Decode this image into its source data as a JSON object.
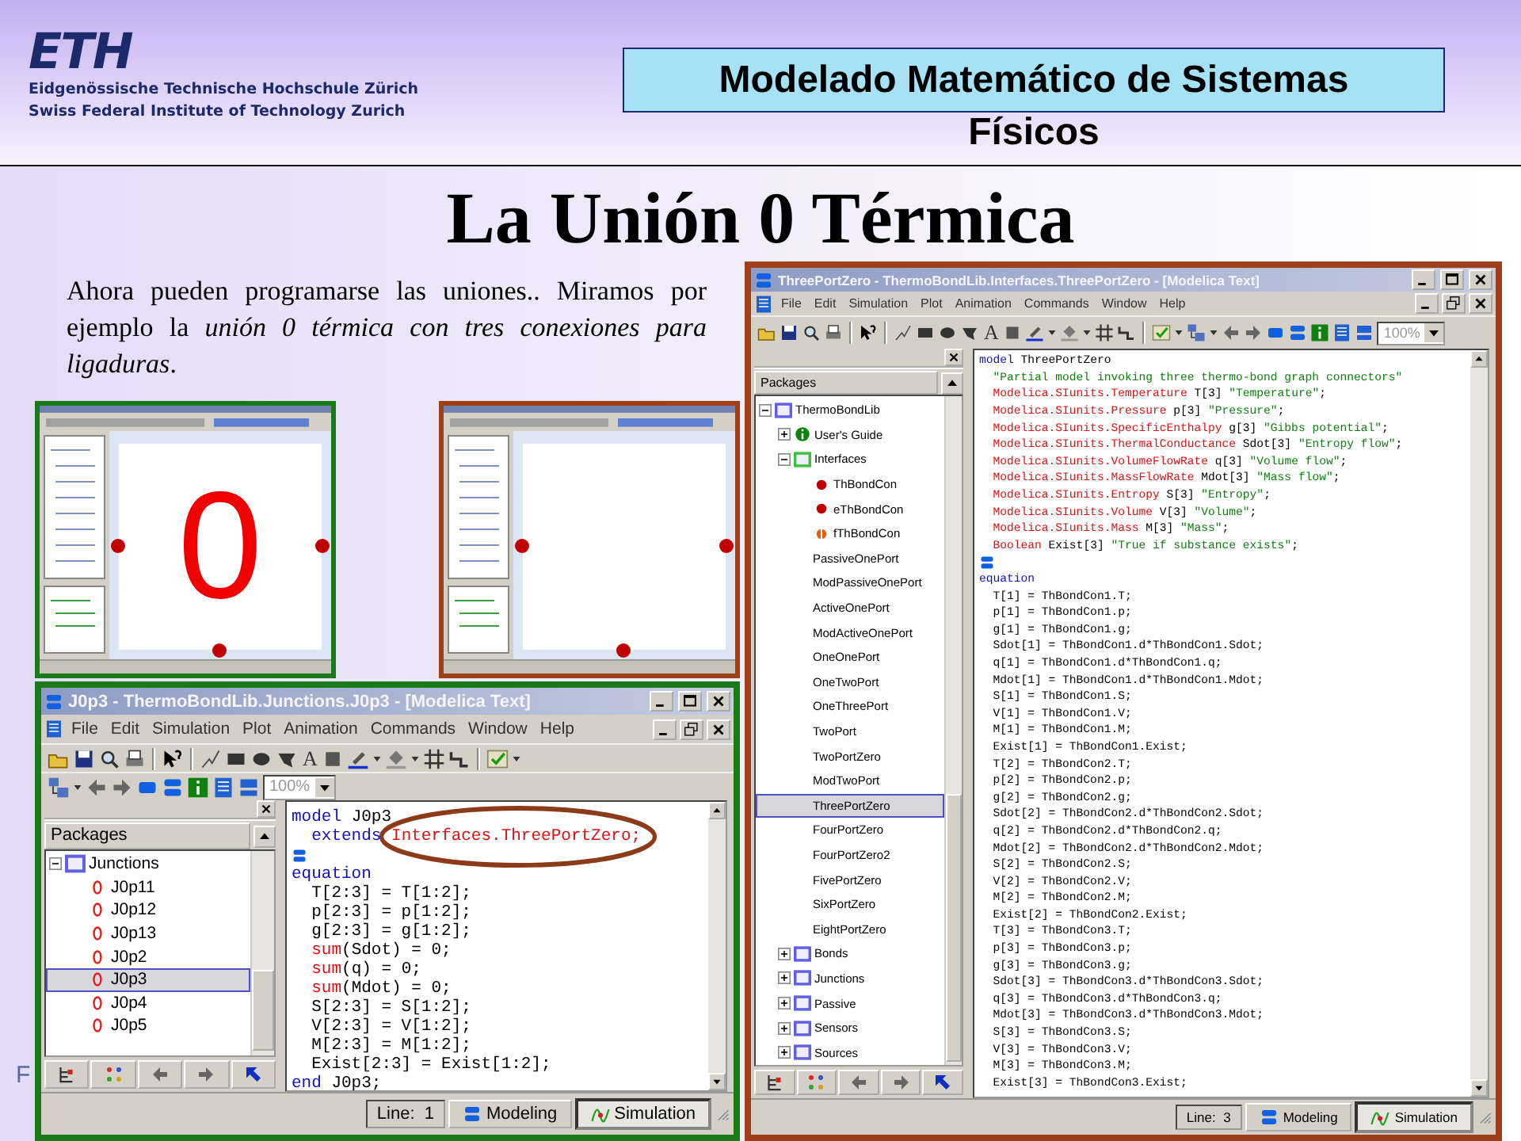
{
  "logo": {
    "mark": "ETH",
    "lines": [
      "Eidgenössische Technische Hochschule Zürich",
      "Swiss Federal Institute of Technology Zurich"
    ]
  },
  "header_title": [
    "Modelado Matemático de Sistemas",
    "Físicos"
  ],
  "title": "La Unión 0 Térmica",
  "paragraph": "Ahora pueden programarse las uniones.. Miramos por ejemplo la *unión 0 térmica con tres conexiones para ligaduras*.",
  "thumbnails": [
    {
      "color": "#1a7a1a",
      "symbol": "0"
    },
    {
      "color": "#a0401a"
    }
  ],
  "footer": "F",
  "windows": [
    {
      "title": "J0p3 - ThermoBondLib.Junctions.J0p3 - [Modelica Text]",
      "color": "#1a7a1a",
      "menu": [
        "File",
        "Edit",
        "Simulation",
        "Plot",
        "Animation",
        "Commands",
        "Window",
        "Help"
      ],
      "text_tool": "A",
      "zoom": "100%",
      "panel_title": "Packages",
      "tree": [
        {
          "label": "Junctions",
          "kind": "package",
          "color": "#6060e0",
          "expanded": true,
          "selected": false,
          "children": [
            {
              "label": "J0p11",
              "kind": "junction",
              "selected": false
            },
            {
              "label": "J0p12",
              "kind": "junction",
              "selected": false
            },
            {
              "label": "J0p13",
              "kind": "junction",
              "selected": false
            },
            {
              "label": "J0p2",
              "kind": "junction",
              "selected": false
            },
            {
              "label": "J0p3",
              "kind": "junction",
              "selected": true
            },
            {
              "label": "J0p4",
              "kind": "junction",
              "selected": false
            },
            {
              "label": "J0p5",
              "kind": "junction",
              "selected": false
            }
          ]
        }
      ],
      "code": [
        {
          "kind": "code",
          "segments": [
            {
              "kind": "keyword",
              "text": "model"
            },
            {
              "kind": "plain",
              "text": " J0p3"
            }
          ]
        },
        {
          "kind": "code",
          "circled": true,
          "segments": [
            {
              "kind": "keyword",
              "text": "  extends"
            },
            {
              "kind": "type",
              "text": " Interfaces.ThreePortZero;"
            }
          ]
        },
        {
          "kind": "annotation"
        },
        {
          "kind": "code",
          "segments": [
            {
              "kind": "keyword",
              "text": "equation"
            }
          ]
        },
        {
          "kind": "code",
          "segments": [
            {
              "kind": "plain",
              "text": "  T[2:3] = T[1:2];"
            }
          ]
        },
        {
          "kind": "code",
          "segments": [
            {
              "kind": "plain",
              "text": "  p[2:3] = p[1:2];"
            }
          ]
        },
        {
          "kind": "code",
          "segments": [
            {
              "kind": "plain",
              "text": "  g[2:3] = g[1:2];"
            }
          ]
        },
        {
          "kind": "code",
          "segments": [
            {
              "kind": "type",
              "text": "  sum"
            },
            {
              "kind": "plain",
              "text": "(Sdot) = 0;"
            }
          ]
        },
        {
          "kind": "code",
          "segments": [
            {
              "kind": "type",
              "text": "  sum"
            },
            {
              "kind": "plain",
              "text": "(q) = 0;"
            }
          ]
        },
        {
          "kind": "code",
          "segments": [
            {
              "kind": "type",
              "text": "  sum"
            },
            {
              "kind": "plain",
              "text": "(Mdot) = 0;"
            }
          ]
        },
        {
          "kind": "code",
          "segments": [
            {
              "kind": "plain",
              "text": "  S[2:3] = S[1:2];"
            }
          ]
        },
        {
          "kind": "code",
          "segments": [
            {
              "kind": "plain",
              "text": "  V[2:3] = V[1:2];"
            }
          ]
        },
        {
          "kind": "code",
          "segments": [
            {
              "kind": "plain",
              "text": "  M[2:3] = M[1:2];"
            }
          ]
        },
        {
          "kind": "code",
          "segments": [
            {
              "kind": "plain",
              "text": "  Exist[2:3] = Exist[1:2];"
            }
          ]
        },
        {
          "kind": "code",
          "segments": [
            {
              "kind": "keyword",
              "text": "end"
            },
            {
              "kind": "plain",
              "text": " J0p3;"
            }
          ]
        }
      ],
      "status": {
        "line_label": "Line:",
        "line": "1",
        "buttons": [
          {
            "label": "Modeling",
            "kind": "modeling",
            "selected": false
          },
          {
            "label": "Simulation",
            "kind": "simulation",
            "selected": true
          }
        ]
      }
    },
    {
      "title": "ThreePortZero - ThermoBondLib.Interfaces.ThreePortZero - [Modelica Text]",
      "color": "#a0401a",
      "menu": [
        "File",
        "Edit",
        "Simulation",
        "Plot",
        "Animation",
        "Commands",
        "Window",
        "Help"
      ],
      "text_tool": "A",
      "zoom": "100%",
      "panel_title": "Packages",
      "tree": [
        {
          "label": "ThermoBondLib",
          "kind": "package",
          "color": "#6060e0",
          "expanded": true,
          "selected": false,
          "children": [
            {
              "label": "User's Guide",
              "kind": "info",
              "expanded": false,
              "selected": false
            },
            {
              "label": "Interfaces",
              "kind": "package",
              "color": "#40c040",
              "expanded": true,
              "selected": false,
              "children": [
                {
                  "label": "ThBondCon",
                  "kind": "connector",
                  "selected": false
                },
                {
                  "label": "eThBondCon",
                  "kind": "connector",
                  "selected": false
                },
                {
                  "label": "fThBondCon",
                  "kind": "connector-half",
                  "selected": false
                },
                {
                  "label": "PassiveOnePort",
                  "kind": "model",
                  "selected": false
                },
                {
                  "label": "ModPassiveOnePort",
                  "kind": "model",
                  "selected": false
                },
                {
                  "label": "ActiveOnePort",
                  "kind": "model",
                  "selected": false
                },
                {
                  "label": "ModActiveOnePort",
                  "kind": "model",
                  "selected": false
                },
                {
                  "label": "OneOnePort",
                  "kind": "model",
                  "selected": false
                },
                {
                  "label": "OneTwoPort",
                  "kind": "model",
                  "selected": false
                },
                {
                  "label": "OneThreePort",
                  "kind": "model",
                  "selected": false
                },
                {
                  "label": "TwoPort",
                  "kind": "model",
                  "selected": false
                },
                {
                  "label": "TwoPortZero",
                  "kind": "model",
                  "selected": false
                },
                {
                  "label": "ModTwoPort",
                  "kind": "model",
                  "selected": false
                },
                {
                  "label": "ThreePortZero",
                  "kind": "model",
                  "selected": true
                },
                {
                  "label": "FourPortZero",
                  "kind": "model",
                  "selected": false
                },
                {
                  "label": "FourPortZero2",
                  "kind": "model",
                  "selected": false
                },
                {
                  "label": "FivePortZero",
                  "kind": "model",
                  "selected": false
                },
                {
                  "label": "SixPortZero",
                  "kind": "model",
                  "selected": false
                },
                {
                  "label": "EightPortZero",
                  "kind": "model",
                  "selected": false
                }
              ]
            },
            {
              "label": "Bonds",
              "kind": "package",
              "color": "#6060e0",
              "expanded": false,
              "selected": false
            },
            {
              "label": "Junctions",
              "kind": "package",
              "color": "#6060e0",
              "expanded": false,
              "selected": false
            },
            {
              "label": "Passive",
              "kind": "package",
              "color": "#6060e0",
              "expanded": false,
              "selected": false
            },
            {
              "label": "Sensors",
              "kind": "package",
              "color": "#6060e0",
              "expanded": false,
              "selected": false
            },
            {
              "label": "Sources",
              "kind": "package",
              "color": "#6060e0",
              "expanded": false,
              "selected": false
            }
          ]
        }
      ],
      "code": [
        {
          "kind": "code",
          "segments": [
            {
              "kind": "keyword",
              "text": "model"
            },
            {
              "kind": "plain",
              "text": " ThreePortZero"
            }
          ]
        },
        {
          "kind": "code",
          "segments": [
            {
              "kind": "string",
              "text": "  \"Partial model invoking three thermo-bond graph connectors\""
            }
          ]
        },
        {
          "kind": "code",
          "segments": [
            {
              "kind": "type",
              "text": "  Modelica.SIunits.Temperature"
            },
            {
              "kind": "plain",
              "text": " T[3] "
            },
            {
              "kind": "string",
              "text": "\"Temperature\""
            },
            {
              "kind": "plain",
              "text": ";"
            }
          ]
        },
        {
          "kind": "code",
          "segments": [
            {
              "kind": "type",
              "text": "  Modelica.SIunits.Pressure"
            },
            {
              "kind": "plain",
              "text": " p[3] "
            },
            {
              "kind": "string",
              "text": "\"Pressure\""
            },
            {
              "kind": "plain",
              "text": ";"
            }
          ]
        },
        {
          "kind": "code",
          "segments": [
            {
              "kind": "type",
              "text": "  Modelica.SIunits.SpecificEnthalpy"
            },
            {
              "kind": "plain",
              "text": " g[3] "
            },
            {
              "kind": "string",
              "text": "\"Gibbs potential\""
            },
            {
              "kind": "plain",
              "text": ";"
            }
          ]
        },
        {
          "kind": "code",
          "segments": [
            {
              "kind": "type",
              "text": "  Modelica.SIunits.ThermalConductance"
            },
            {
              "kind": "plain",
              "text": " Sdot[3] "
            },
            {
              "kind": "string",
              "text": "\"Entropy flow\""
            },
            {
              "kind": "plain",
              "text": ";"
            }
          ]
        },
        {
          "kind": "code",
          "segments": [
            {
              "kind": "type",
              "text": "  Modelica.SIunits.VolumeFlowRate"
            },
            {
              "kind": "plain",
              "text": " q[3] "
            },
            {
              "kind": "string",
              "text": "\"Volume flow\""
            },
            {
              "kind": "plain",
              "text": ";"
            }
          ]
        },
        {
          "kind": "code",
          "segments": [
            {
              "kind": "type",
              "text": "  Modelica.SIunits.MassFlowRate"
            },
            {
              "kind": "plain",
              "text": " Mdot[3] "
            },
            {
              "kind": "string",
              "text": "\"Mass flow\""
            },
            {
              "kind": "plain",
              "text": ";"
            }
          ]
        },
        {
          "kind": "code",
          "segments": [
            {
              "kind": "type",
              "text": "  Modelica.SIunits.Entropy"
            },
            {
              "kind": "plain",
              "text": " S[3] "
            },
            {
              "kind": "string",
              "text": "\"Entropy\""
            },
            {
              "kind": "plain",
              "text": ";"
            }
          ]
        },
        {
          "kind": "code",
          "segments": [
            {
              "kind": "type",
              "text": "  Modelica.SIunits.Volume"
            },
            {
              "kind": "plain",
              "text": " V[3] "
            },
            {
              "kind": "string",
              "text": "\"Volume\""
            },
            {
              "kind": "plain",
              "text": ";"
            }
          ]
        },
        {
          "kind": "code",
          "segments": [
            {
              "kind": "type",
              "text": "  Modelica.SIunits.Mass"
            },
            {
              "kind": "plain",
              "text": " M[3] "
            },
            {
              "kind": "string",
              "text": "\"Mass\""
            },
            {
              "kind": "plain",
              "text": ";"
            }
          ]
        },
        {
          "kind": "code",
          "segments": [
            {
              "kind": "type",
              "text": "  Boolean"
            },
            {
              "kind": "plain",
              "text": " Exist[3] "
            },
            {
              "kind": "string",
              "text": "\"True if substance exists\""
            },
            {
              "kind": "plain",
              "text": ";"
            }
          ]
        },
        {
          "kind": "annotation"
        },
        {
          "kind": "code",
          "segments": [
            {
              "kind": "keyword",
              "text": "equation"
            }
          ]
        },
        {
          "kind": "code",
          "segments": [
            {
              "kind": "plain",
              "text": "  T[1] = ThBondCon1.T;"
            }
          ]
        },
        {
          "kind": "code",
          "segments": [
            {
              "kind": "plain",
              "text": "  p[1] = ThBondCon1.p;"
            }
          ]
        },
        {
          "kind": "code",
          "segments": [
            {
              "kind": "plain",
              "text": "  g[1] = ThBondCon1.g;"
            }
          ]
        },
        {
          "kind": "code",
          "segments": [
            {
              "kind": "plain",
              "text": "  Sdot[1] = ThBondCon1.d*ThBondCon1.Sdot;"
            }
          ]
        },
        {
          "kind": "code",
          "segments": [
            {
              "kind": "plain",
              "text": "  q[1] = ThBondCon1.d*ThBondCon1.q;"
            }
          ]
        },
        {
          "kind": "code",
          "segments": [
            {
              "kind": "plain",
              "text": "  Mdot[1] = ThBondCon1.d*ThBondCon1.Mdot;"
            }
          ]
        },
        {
          "kind": "code",
          "segments": [
            {
              "kind": "plain",
              "text": "  S[1] = ThBondCon1.S;"
            }
          ]
        },
        {
          "kind": "code",
          "segments": [
            {
              "kind": "plain",
              "text": "  V[1] = ThBondCon1.V;"
            }
          ]
        },
        {
          "kind": "code",
          "segments": [
            {
              "kind": "plain",
              "text": "  M[1] = ThBondCon1.M;"
            }
          ]
        },
        {
          "kind": "code",
          "segments": [
            {
              "kind": "plain",
              "text": "  Exist[1] = ThBondCon1.Exist;"
            }
          ]
        },
        {
          "kind": "code",
          "segments": [
            {
              "kind": "plain",
              "text": "  T[2] = ThBondCon2.T;"
            }
          ]
        },
        {
          "kind": "code",
          "segments": [
            {
              "kind": "plain",
              "text": "  p[2] = ThBondCon2.p;"
            }
          ]
        },
        {
          "kind": "code",
          "segments": [
            {
              "kind": "plain",
              "text": "  g[2] = ThBondCon2.g;"
            }
          ]
        },
        {
          "kind": "code",
          "segments": [
            {
              "kind": "plain",
              "text": "  Sdot[2] = ThBondCon2.d*ThBondCon2.Sdot;"
            }
          ]
        },
        {
          "kind": "code",
          "segments": [
            {
              "kind": "plain",
              "text": "  q[2] = ThBondCon2.d*ThBondCon2.q;"
            }
          ]
        },
        {
          "kind": "code",
          "segments": [
            {
              "kind": "plain",
              "text": "  Mdot[2] = ThBondCon2.d*ThBondCon2.Mdot;"
            }
          ]
        },
        {
          "kind": "code",
          "segments": [
            {
              "kind": "plain",
              "text": "  S[2] = ThBondCon2.S;"
            }
          ]
        },
        {
          "kind": "code",
          "segments": [
            {
              "kind": "plain",
              "text": "  V[2] = ThBondCon2.V;"
            }
          ]
        },
        {
          "kind": "code",
          "segments": [
            {
              "kind": "plain",
              "text": "  M[2] = ThBondCon2.M;"
            }
          ]
        },
        {
          "kind": "code",
          "segments": [
            {
              "kind": "plain",
              "text": "  Exist[2] = ThBondCon2.Exist;"
            }
          ]
        },
        {
          "kind": "code",
          "segments": [
            {
              "kind": "plain",
              "text": "  T[3] = ThBondCon3.T;"
            }
          ]
        },
        {
          "kind": "code",
          "segments": [
            {
              "kind": "plain",
              "text": "  p[3] = ThBondCon3.p;"
            }
          ]
        },
        {
          "kind": "code",
          "segments": [
            {
              "kind": "plain",
              "text": "  g[3] = ThBondCon3.g;"
            }
          ]
        },
        {
          "kind": "code",
          "segments": [
            {
              "kind": "plain",
              "text": "  Sdot[3] = ThBondCon3.d*ThBondCon3.Sdot;"
            }
          ]
        },
        {
          "kind": "code",
          "segments": [
            {
              "kind": "plain",
              "text": "  q[3] = ThBondCon3.d*ThBondCon3.q;"
            }
          ]
        },
        {
          "kind": "code",
          "segments": [
            {
              "kind": "plain",
              "text": "  Mdot[3] = ThBondCon3.d*ThBondCon3.Mdot;"
            }
          ]
        },
        {
          "kind": "code",
          "segments": [
            {
              "kind": "plain",
              "text": "  S[3] = ThBondCon3.S;"
            }
          ]
        },
        {
          "kind": "code",
          "segments": [
            {
              "kind": "plain",
              "text": "  V[3] = ThBondCon3.V;"
            }
          ]
        },
        {
          "kind": "code",
          "segments": [
            {
              "kind": "plain",
              "text": "  M[3] = ThBondCon3.M;"
            }
          ]
        },
        {
          "kind": "code",
          "segments": [
            {
              "kind": "plain",
              "text": "  Exist[3] = ThBondCon3.Exist;"
            }
          ]
        }
      ],
      "status": {
        "line_label": "Line:",
        "line": "3",
        "buttons": [
          {
            "label": "Modeling",
            "kind": "modeling",
            "selected": false
          },
          {
            "label": "Simulation",
            "kind": "simulation",
            "selected": true
          }
        ]
      }
    }
  ]
}
